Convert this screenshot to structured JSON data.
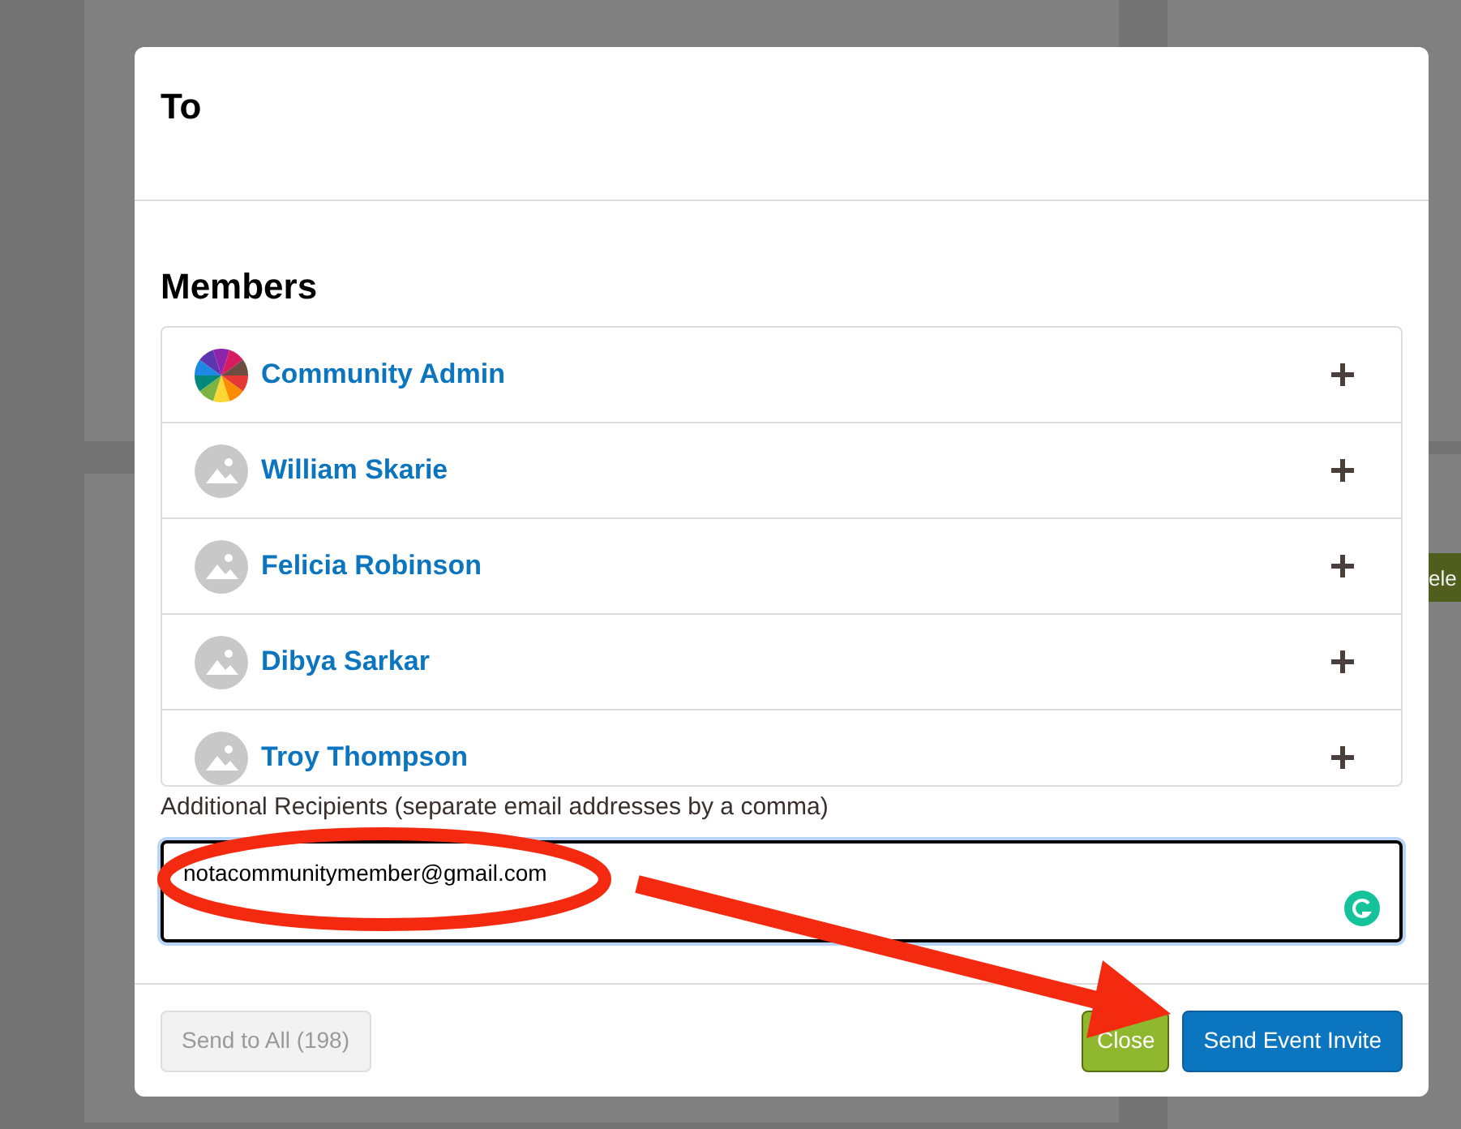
{
  "background": {
    "texts": [
      "ele"
    ]
  },
  "dialog": {
    "title": "To",
    "members_heading": "Members",
    "members": [
      {
        "name": "Community Admin",
        "kind": "logo"
      },
      {
        "name": "William Skarie",
        "kind": "placeholder"
      },
      {
        "name": "Felicia Robinson",
        "kind": "placeholder"
      },
      {
        "name": "Dibya Sarkar",
        "kind": "placeholder"
      },
      {
        "name": "Troy Thompson",
        "kind": "placeholder"
      }
    ],
    "additional_label": "Additional Recipients (separate email addresses by a comma)",
    "additional_value": "notacommunitymember@gmail.com",
    "buttons": [
      {
        "label": "Send to All (198)",
        "kind": "secondary",
        "disabled": true
      },
      {
        "label": "Close",
        "kind": "close",
        "disabled": false
      },
      {
        "label": "Send Event Invite",
        "kind": "primary",
        "disabled": false
      }
    ]
  }
}
